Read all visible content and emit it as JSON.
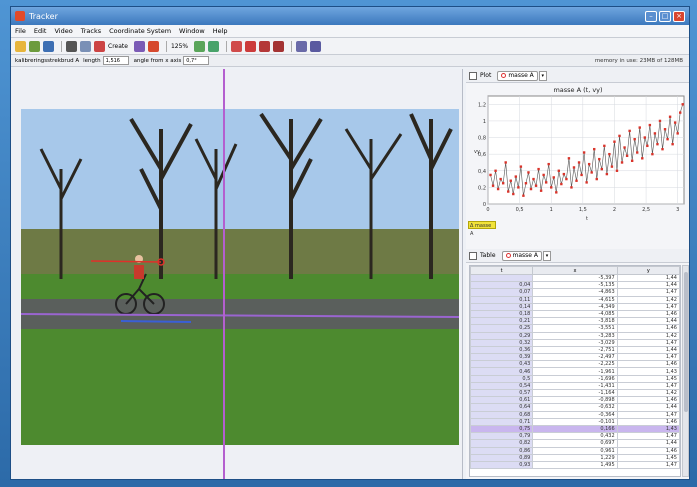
{
  "window": {
    "title": "Tracker"
  },
  "menu": [
    "File",
    "Edit",
    "Video",
    "Tracks",
    "Coordinate System",
    "Window",
    "Help"
  ],
  "toolbar": {
    "create_label": "Create",
    "zoom": "125%"
  },
  "propbar": {
    "track_name": "kalibreringsstrekbrud A",
    "length_label": "length",
    "length_value": "1,516",
    "angle_label": "angle from x axis",
    "angle_value": "0,7°",
    "memory": "memory in use: 23MB of 128MB"
  },
  "plot": {
    "tab_label": "Plot",
    "track": "masse A",
    "title": "masse A (t, vy)",
    "ylabel": "vy",
    "xlabel": "t",
    "tag": "Δ masse A"
  },
  "table": {
    "tab_label": "Table",
    "track": "masse A",
    "columns": [
      "t",
      "x",
      "y"
    ],
    "rows": [
      [
        "",
        "-5,397",
        "1,44"
      ],
      [
        "0,04",
        "-5,135",
        "1,44"
      ],
      [
        "0,07",
        "-4,863",
        "1,47"
      ],
      [
        "0,11",
        "-4,615",
        "1,42"
      ],
      [
        "0,14",
        "-4,349",
        "1,47"
      ],
      [
        "0,18",
        "-4,085",
        "1,46"
      ],
      [
        "0,21",
        "-3,818",
        "1,44"
      ],
      [
        "0,25",
        "-3,551",
        "1,46"
      ],
      [
        "0,29",
        "-3,283",
        "1,42"
      ],
      [
        "0,32",
        "-3,029",
        "1,47"
      ],
      [
        "0,36",
        "-2,751",
        "1,44"
      ],
      [
        "0,39",
        "-2,497",
        "1,47"
      ],
      [
        "0,43",
        "-2,225",
        "1,46"
      ],
      [
        "0,46",
        "-1,961",
        "1,43"
      ],
      [
        "0,5",
        "-1,696",
        "1,45"
      ],
      [
        "0,54",
        "-1,431",
        "1,47"
      ],
      [
        "0,57",
        "-1,164",
        "1,42"
      ],
      [
        "0,61",
        "-0,898",
        "1,46"
      ],
      [
        "0,64",
        "-0,632",
        "1,44"
      ],
      [
        "0,68",
        "-0,364",
        "1,47"
      ],
      [
        "0,71",
        "-0,101",
        "1,46"
      ],
      [
        "0,75",
        "0,166",
        "1,43"
      ],
      [
        "0,79",
        "0,432",
        "1,47"
      ],
      [
        "0,82",
        "0,697",
        "1,44"
      ],
      [
        "0,86",
        "0,961",
        "1,46"
      ],
      [
        "0,89",
        "1,229",
        "1,45"
      ],
      [
        "0,93",
        "1,495",
        "1,47"
      ]
    ],
    "selected_row": 21
  },
  "chart_data": {
    "type": "line",
    "title": "masse A (t, vy)",
    "xlabel": "t",
    "ylabel": "vy",
    "xlim": [
      0,
      3.1
    ],
    "ylim": [
      0,
      1.3
    ],
    "xticks": [
      "0",
      "0,5",
      "1",
      "1,5",
      "2",
      "2,5",
      "3"
    ],
    "yticks": [
      "0",
      "0,2",
      "0,4",
      "0,6",
      "0,8",
      "1",
      "1,2"
    ],
    "x": [
      0.04,
      0.08,
      0.12,
      0.16,
      0.2,
      0.24,
      0.28,
      0.32,
      0.36,
      0.4,
      0.44,
      0.48,
      0.52,
      0.56,
      0.6,
      0.64,
      0.68,
      0.72,
      0.76,
      0.8,
      0.84,
      0.88,
      0.92,
      0.96,
      1.0,
      1.04,
      1.08,
      1.12,
      1.16,
      1.2,
      1.24,
      1.28,
      1.32,
      1.36,
      1.4,
      1.44,
      1.48,
      1.52,
      1.56,
      1.6,
      1.64,
      1.68,
      1.72,
      1.76,
      1.8,
      1.84,
      1.88,
      1.92,
      1.96,
      2.0,
      2.04,
      2.08,
      2.12,
      2.16,
      2.2,
      2.24,
      2.28,
      2.32,
      2.36,
      2.4,
      2.44,
      2.48,
      2.52,
      2.56,
      2.6,
      2.64,
      2.68,
      2.72,
      2.76,
      2.8,
      2.84,
      2.88,
      2.92,
      2.96,
      3.0,
      3.04,
      3.08
    ],
    "series": [
      {
        "color": "#d9342b",
        "values": [
          0.35,
          0.22,
          0.4,
          0.18,
          0.3,
          0.25,
          0.5,
          0.15,
          0.28,
          0.12,
          0.33,
          0.2,
          0.45,
          0.1,
          0.25,
          0.38,
          0.18,
          0.3,
          0.22,
          0.42,
          0.16,
          0.35,
          0.26,
          0.48,
          0.2,
          0.32,
          0.14,
          0.4,
          0.24,
          0.36,
          0.3,
          0.55,
          0.2,
          0.44,
          0.28,
          0.5,
          0.35,
          0.62,
          0.26,
          0.48,
          0.38,
          0.66,
          0.3,
          0.54,
          0.42,
          0.7,
          0.36,
          0.6,
          0.45,
          0.75,
          0.4,
          0.82,
          0.5,
          0.68,
          0.58,
          0.88,
          0.52,
          0.78,
          0.62,
          0.92,
          0.55,
          0.8,
          0.7,
          0.95,
          0.6,
          0.85,
          0.72,
          1.0,
          0.66,
          0.9,
          0.78,
          1.05,
          0.72,
          0.98,
          0.85,
          1.1,
          1.2
        ]
      }
    ]
  }
}
